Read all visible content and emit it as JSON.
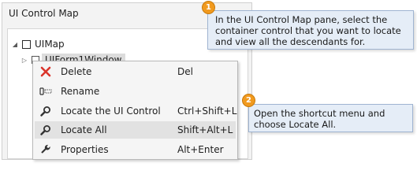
{
  "pane": {
    "title": "UI Control Map",
    "tree": [
      {
        "label": "UIMap"
      },
      {
        "label": "UIForm1Window"
      }
    ]
  },
  "menu": {
    "items": [
      {
        "icon": "delete-x-icon",
        "label": "Delete",
        "shortcut": "Del"
      },
      {
        "icon": "rename-icon",
        "label": "Rename",
        "shortcut": ""
      },
      {
        "icon": "search-icon",
        "label": "Locate the UI Control",
        "shortcut": "Ctrl+Shift+L"
      },
      {
        "icon": "search-icon",
        "label": "Locate All",
        "shortcut": "Shift+Alt+L"
      },
      {
        "icon": "wrench-icon",
        "label": "Properties",
        "shortcut": "Alt+Enter"
      }
    ]
  },
  "callouts": [
    {
      "number": "1",
      "text": "In the UI Control Map pane, select the container control that you want to locate and view all the descendants for."
    },
    {
      "number": "2",
      "text": "Open the shortcut menu and choose Locate All."
    }
  ],
  "colors": {
    "badge": "#f19a1f",
    "callout_bg": "#e5edf7",
    "delete_icon": "#d9342b"
  }
}
